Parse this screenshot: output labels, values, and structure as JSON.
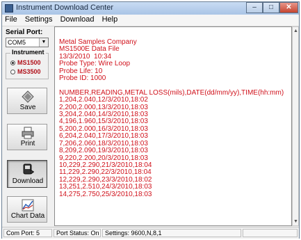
{
  "window": {
    "title": "Instrument Download Center",
    "min": "–",
    "max": "□",
    "close": "✕"
  },
  "menu": [
    {
      "label": "File"
    },
    {
      "label": "Settings"
    },
    {
      "label": "Download"
    },
    {
      "label": "Help"
    }
  ],
  "left": {
    "serial_port_label": "Serial Port:",
    "serial_port_value": "COM5",
    "instrument_label": "Instrument",
    "radio_ms1500": "MS1500",
    "radio_ms3500": "MS3500",
    "selected_instrument": "MS1500",
    "tools": [
      {
        "label": "Save",
        "icon": "diamond-icon"
      },
      {
        "label": "Print",
        "icon": "printer-icon"
      },
      {
        "label": "Download",
        "icon": "download-icon"
      },
      {
        "label": "Chart Data",
        "icon": "chart-icon"
      }
    ]
  },
  "content": {
    "lines": [
      "Metal Samples Company",
      "MS1500E Data File",
      "13/3/2010  10:34",
      "Probe Type: Wire Loop",
      "Probe Life: 10",
      "Probe ID: 1000",
      "",
      "NUMBER,READING,METAL LOSS(mils),DATE(dd/mm/yy),TIME(hh:mm)",
      "1,204,2.040,12/3/2010,18:02",
      "2,200,2.000,13/3/2010,18:03",
      "3,204,2.040,14/3/2010,18:03",
      "4,196,1.960,15/3/2010,18:03",
      "5,200,2.000,16/3/2010,18:03",
      "6,204,2.040,17/3/2010,18:03",
      "7,206,2.060,18/3/2010,18:03",
      "8,209,2.090,19/3/2010,18:03",
      "9,220,2.200,20/3/2010,18:03",
      "10,229,2.290,21/3/2010,18:04",
      "11,229,2.290,22/3/2010,18:04",
      "12,229,2.290,23/3/2010,18:02",
      "13,251,2.510,24/3/2010,18:03",
      "14,275,2.750,25/3/2010,18:03"
    ]
  },
  "status": {
    "com_port": "Com Port: 5",
    "port_status": "Port Status:  On",
    "settings": "Settings:  9600,N,8,1"
  }
}
